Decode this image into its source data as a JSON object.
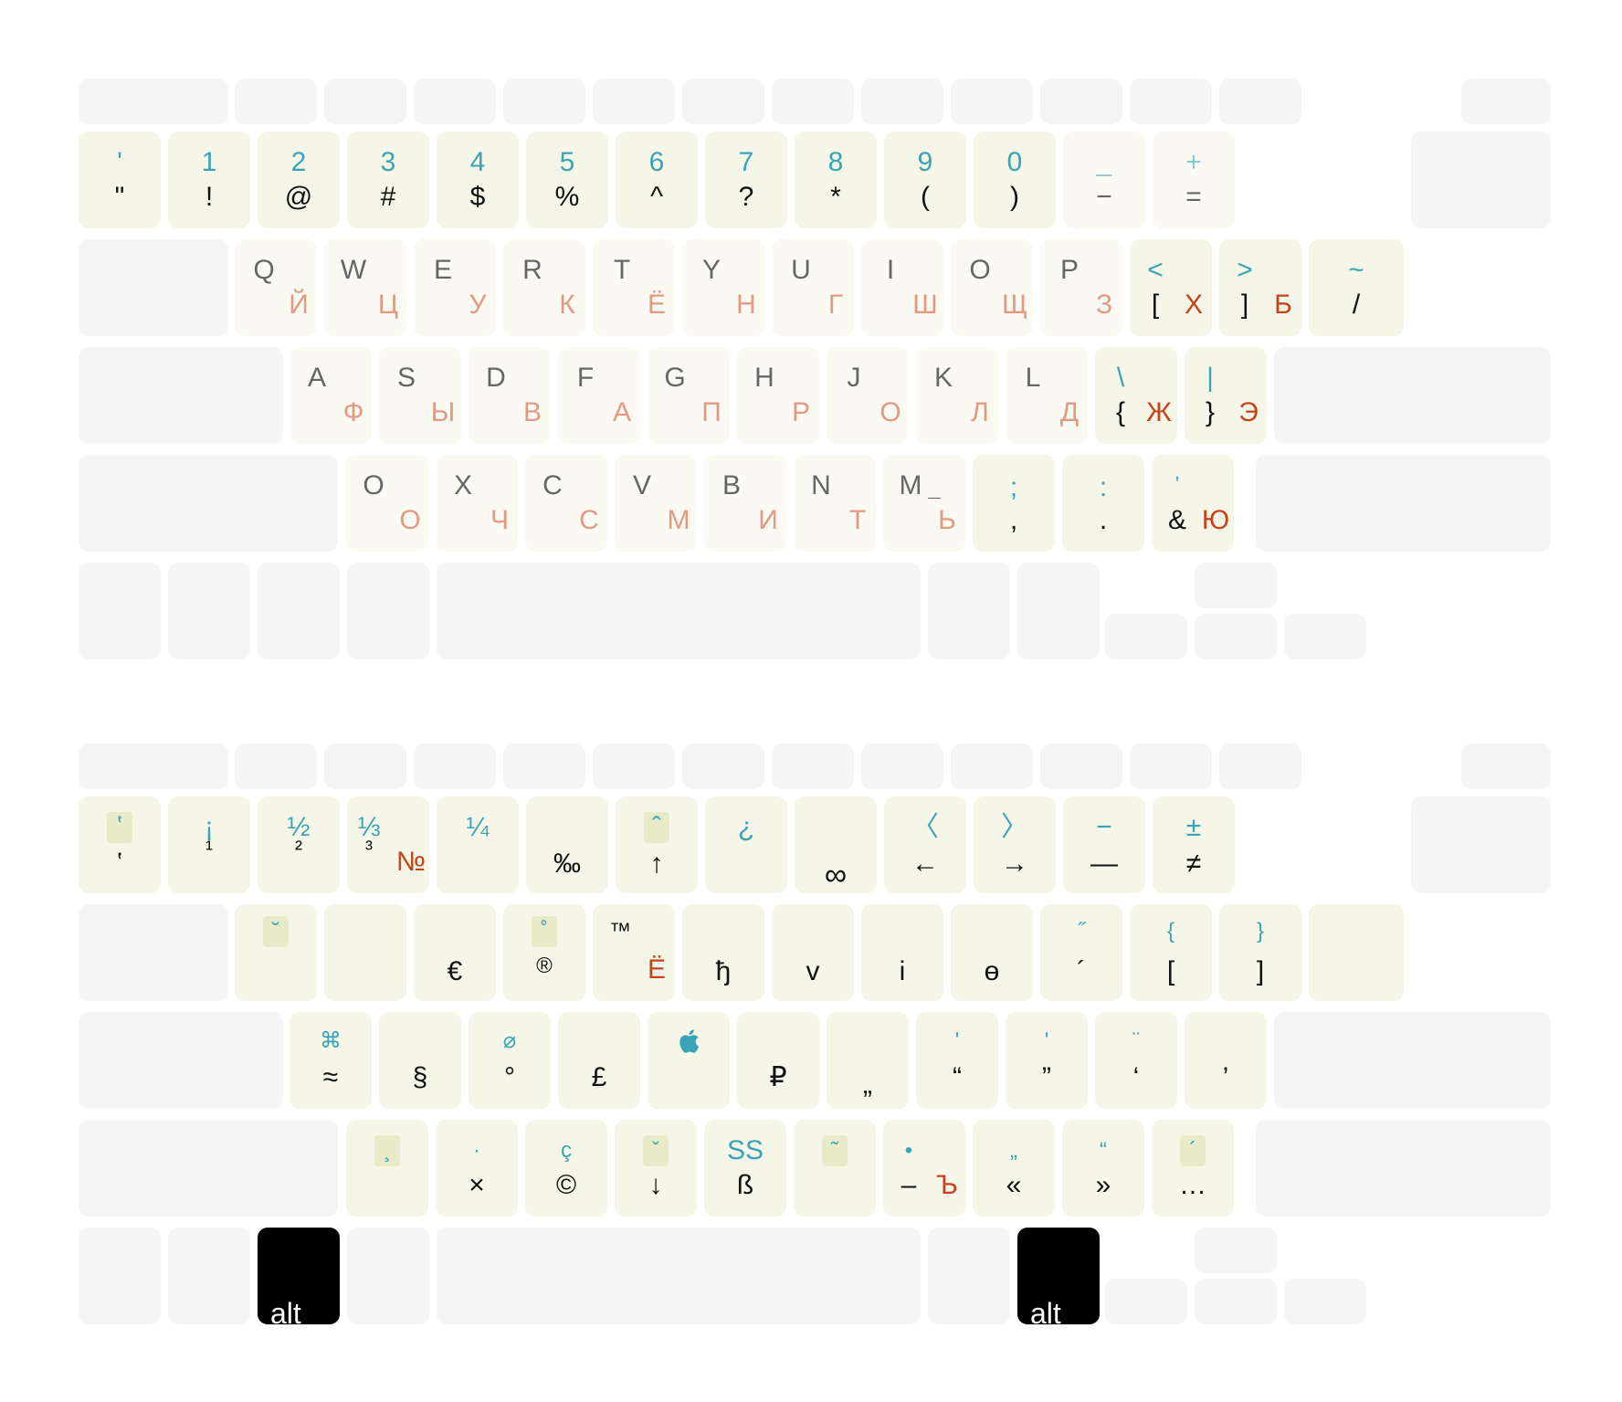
{
  "colors": {
    "key_bg": "#f5f5f5",
    "key_active": "#f5f6e7",
    "key_letter": "#fafaf3",
    "teal": "#3aa3b8",
    "red": "#c4441c",
    "light_red": "#e29a83",
    "black": "#000000"
  },
  "base": {
    "r1": [
      {
        "top": "ʹ",
        "bottom": "\""
      },
      {
        "top": "1",
        "bottom": "!"
      },
      {
        "top": "2",
        "bottom": "@"
      },
      {
        "top": "3",
        "bottom": "#"
      },
      {
        "top": "4",
        "bottom": "$"
      },
      {
        "top": "5",
        "bottom": "%"
      },
      {
        "top": "6",
        "bottom": "^"
      },
      {
        "top": "7",
        "bottom": "?"
      },
      {
        "top": "8",
        "bottom": "*"
      },
      {
        "top": "9",
        "bottom": "("
      },
      {
        "top": "0",
        "bottom": ")"
      },
      {
        "top": "_",
        "bottom": "−"
      },
      {
        "top": "+",
        "bottom": "="
      }
    ],
    "r2": [
      {
        "latin": "Q",
        "cyr": "Й"
      },
      {
        "latin": "W",
        "cyr": "Ц"
      },
      {
        "latin": "E",
        "cyr": "У"
      },
      {
        "latin": "R",
        "cyr": "К"
      },
      {
        "latin": "T",
        "cyr": "Ё"
      },
      {
        "latin": "Y",
        "cyr": "Н"
      },
      {
        "latin": "U",
        "cyr": "Г"
      },
      {
        "latin": "I",
        "cyr": "Ш"
      },
      {
        "latin": "O",
        "cyr": "Щ"
      },
      {
        "latin": "P",
        "cyr": "З"
      },
      {
        "top": "<",
        "bottom": "[",
        "cyr": "Х"
      },
      {
        "top": ">",
        "bottom": "]",
        "cyr": "Б"
      },
      {
        "top": "~",
        "bottom": "/"
      }
    ],
    "r3": [
      {
        "latin": "A",
        "cyr": "Ф"
      },
      {
        "latin": "S",
        "cyr": "Ы"
      },
      {
        "latin": "D",
        "cyr": "В"
      },
      {
        "latin": "F",
        "cyr": "А"
      },
      {
        "latin": "G",
        "cyr": "П"
      },
      {
        "latin": "H",
        "cyr": "Р"
      },
      {
        "latin": "J",
        "cyr": "О"
      },
      {
        "latin": "K",
        "cyr": "Л"
      },
      {
        "latin": "L",
        "cyr": "Д"
      },
      {
        "top": "\\",
        "bottom": "{",
        "cyr": "Ж"
      },
      {
        "top": "|",
        "bottom": "}",
        "cyr": "Э"
      }
    ],
    "r4": [
      {
        "latin": "O",
        "cyr": "О"
      },
      {
        "latin": "X",
        "cyr": "Ч"
      },
      {
        "latin": "C",
        "cyr": "С"
      },
      {
        "latin": "V",
        "cyr": "М"
      },
      {
        "latin": "B",
        "cyr": "И"
      },
      {
        "latin": "N",
        "cyr": "Т"
      },
      {
        "latin": "M",
        "cyr": "Ь",
        "mark": "¯"
      },
      {
        "top": ";",
        "bottom": ","
      },
      {
        "top": ":",
        "bottom": "."
      },
      {
        "top": "ʽ",
        "bottom": "&",
        "cyr": "Ю"
      }
    ]
  },
  "alt": {
    "r1": [
      {
        "top": "ʽ",
        "bottom": "ʽ",
        "badge": true
      },
      {
        "top": "¡",
        "bottom": "¹"
      },
      {
        "top": "½",
        "bottom": "²"
      },
      {
        "top": "⅓",
        "bottom": "³",
        "cyr": "№"
      },
      {
        "top": "¼",
        "bottom": ""
      },
      {
        "top": "",
        "bottom": "‰"
      },
      {
        "top": "ˆ",
        "bottom": "↑",
        "badge": true
      },
      {
        "top": "¿",
        "bottom": ""
      },
      {
        "top": "",
        "bottom": "∞"
      },
      {
        "top": "〈",
        "bottom": "←"
      },
      {
        "top": "〉",
        "bottom": "→"
      },
      {
        "top": "−",
        "bottom": "—"
      },
      {
        "top": "±",
        "bottom": "≠"
      }
    ],
    "r2": [
      {
        "top": "˘",
        "bottom": "",
        "badge": true
      },
      {
        "top": "",
        "bottom": ""
      },
      {
        "top": "",
        "bottom": "€"
      },
      {
        "top": "˚",
        "bottom": "®",
        "badge": true
      },
      {
        "top": "™",
        "bottom": "",
        "cyr": "Ё"
      },
      {
        "top": "",
        "bottom": "ђ"
      },
      {
        "top": "",
        "bottom": "v"
      },
      {
        "top": "",
        "bottom": "i"
      },
      {
        "top": "",
        "bottom": "ө"
      },
      {
        "top": "˝",
        "bottom": "´"
      },
      {
        "top": "{",
        "bottom": "["
      },
      {
        "top": "}",
        "bottom": "]"
      }
    ],
    "r3": [
      {
        "top": "⌘",
        "bottom": "≈"
      },
      {
        "top": "",
        "bottom": "§"
      },
      {
        "top": "⌀",
        "bottom": "°"
      },
      {
        "top": "",
        "bottom": "£"
      },
      {
        "top": "apple-icon",
        "bottom": ""
      },
      {
        "top": "",
        "bottom": "₽"
      },
      {
        "top": "",
        "bottom": "„"
      },
      {
        "top": "ʹ",
        "bottom": "“"
      },
      {
        "top": "ʹ",
        "bottom": "”"
      },
      {
        "top": "¨",
        "bottom": "‘"
      },
      {
        "top": "",
        "bottom": "’"
      }
    ],
    "r4": [
      {
        "top": "¸",
        "bottom": "",
        "badge": true
      },
      {
        "top": "·",
        "bottom": "×"
      },
      {
        "top": "ç",
        "bottom": "©"
      },
      {
        "top": "ˇ",
        "bottom": "↓",
        "badge": true
      },
      {
        "top": "SS",
        "bottom": "ß"
      },
      {
        "top": "˜",
        "bottom": "",
        "badge": true
      },
      {
        "top": "•",
        "bottom": "–",
        "cyr": "Ъ"
      },
      {
        "top": "„",
        "bottom": "«"
      },
      {
        "top": "“",
        "bottom": "»"
      },
      {
        "top": "´",
        "bottom": "…",
        "badge": true
      }
    ],
    "modifier": "alt"
  }
}
